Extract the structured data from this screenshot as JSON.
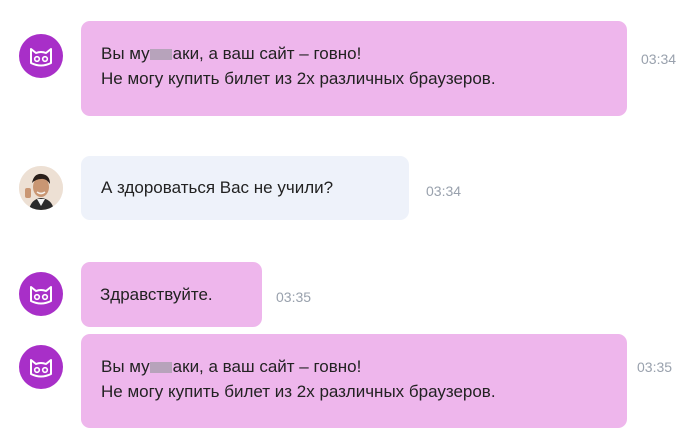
{
  "messages": [
    {
      "sender": "bot",
      "avatar_icon": "cat-face-icon",
      "lines": [
        {
          "before": "Вы му",
          "after": "аки, а ваш сайт – говно!"
        },
        {
          "text": "Не могу купить билет из 2х различных  браузеров."
        }
      ],
      "time": "03:34"
    },
    {
      "sender": "user",
      "avatar_icon": "user-photo-icon",
      "text": "А здороваться Вас не учили?",
      "time": "03:34"
    },
    {
      "sender": "bot",
      "avatar_icon": "cat-face-icon",
      "text": "Здравствуйте.",
      "time": "03:35"
    },
    {
      "sender": "bot",
      "avatar_icon": "cat-face-icon",
      "lines": [
        {
          "before": "Вы му",
          "after": "аки, а ваш сайт – говно!"
        },
        {
          "text": "Не могу купить билет из 2х различных  браузеров."
        }
      ],
      "time": "03:35"
    }
  ],
  "colors": {
    "bot_bubble": "#eeb6ec",
    "user_bubble": "#eef2fa",
    "bot_avatar": "#a82fc8",
    "timestamp": "#99a1ad",
    "message_text": "#222222",
    "censor_mark": "#b7a3bb"
  }
}
